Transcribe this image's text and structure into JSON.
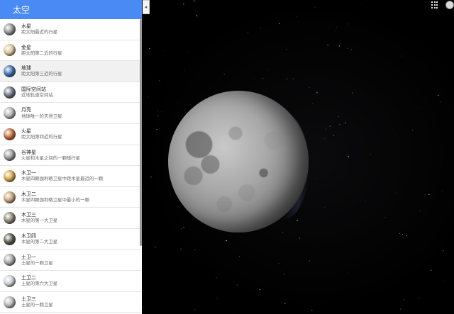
{
  "panel": {
    "title": "太空"
  },
  "collapse_arrow": "◂",
  "items": [
    {
      "name": "水星",
      "desc": "距太阳最近的行星",
      "color": "#8f8f8f"
    },
    {
      "name": "金星",
      "desc": "距太阳第二近的行星",
      "color": "#d9c49a"
    },
    {
      "name": "地球",
      "desc": "距太阳第三近的行星",
      "color": "#3f6fb3"
    },
    {
      "name": "国际空间站",
      "desc": "近地轨道空间站",
      "color": "#6a7382"
    },
    {
      "name": "月亮",
      "desc": "地球唯一的天然卫星",
      "color": "#b2b2b2"
    },
    {
      "name": "火星",
      "desc": "距太阳第四近的行星",
      "color": "#c06a3b"
    },
    {
      "name": "谷神星",
      "desc": "火星和木星之间的一颗矮行星",
      "color": "#9a9a9a"
    },
    {
      "name": "木卫一",
      "desc": "木星四颗伽利略卫星中距木星最近的一颗",
      "color": "#d4a64a"
    },
    {
      "name": "木卫二",
      "desc": "木星四颗伽利略卫星中最小的一颗",
      "color": "#c2a37a"
    },
    {
      "name": "木卫三",
      "desc": "木星的第一大卫星",
      "color": "#8b8373"
    },
    {
      "name": "木卫四",
      "desc": "木星的第二大卫星",
      "color": "#5b5a4e"
    },
    {
      "name": "土卫一",
      "desc": "土星的一颗卫星",
      "color": "#a6a6a6"
    },
    {
      "name": "土卫二",
      "desc": "土星的第六大卫星",
      "color": "#c9cfd3"
    },
    {
      "name": "土卫三",
      "desc": "土星的一颗卫星",
      "color": "#b8b8b8"
    }
  ],
  "selected_index": 2,
  "icons": {
    "apps": "apps-grid-icon",
    "account": "account-avatar"
  }
}
